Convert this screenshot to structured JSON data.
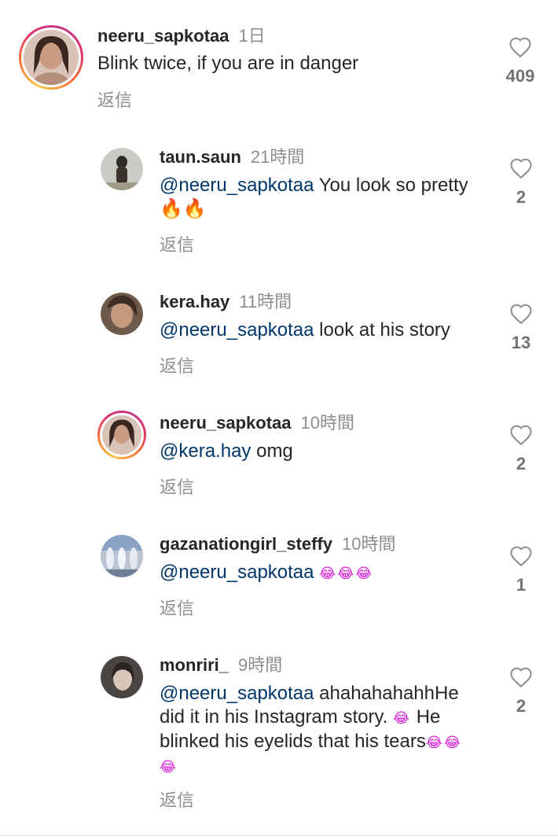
{
  "comments": [
    {
      "username": "neeru_sapkotaa",
      "time": "1日",
      "text": "Blink twice, if you are in danger",
      "reply": "返信",
      "likes": "409"
    },
    {
      "username": "taun.saun",
      "time": "21時間",
      "mention": "@neeru_sapkotaa",
      "text": " You look so pretty ",
      "emoji": "🔥🔥",
      "reply": "返信",
      "likes": "2"
    },
    {
      "username": "kera.hay",
      "time": "11時間",
      "mention": "@neeru_sapkotaa",
      "text": " look at his story",
      "reply": "返信",
      "likes": "13"
    },
    {
      "username": "neeru_sapkotaa",
      "time": "10時間",
      "mention": "@kera.hay",
      "text": " omg",
      "reply": "返信",
      "likes": "2"
    },
    {
      "username": "gazanationgirl_steffy",
      "time": "10時間",
      "mention": "@neeru_sapkotaa",
      "text": " ",
      "emoji": "😂😂😂",
      "reply": "返信",
      "likes": "1"
    },
    {
      "username": "monriri_",
      "time": "9時間",
      "mention": "@neeru_sapkotaa",
      "text": " ahahahahahhHe did it in his Instagram story. ",
      "emoji_1": "😂",
      "text_2": " He blinked his eyelids that his tears",
      "emoji_2": "😂😂😂",
      "reply": "返信",
      "likes": "2"
    }
  ]
}
